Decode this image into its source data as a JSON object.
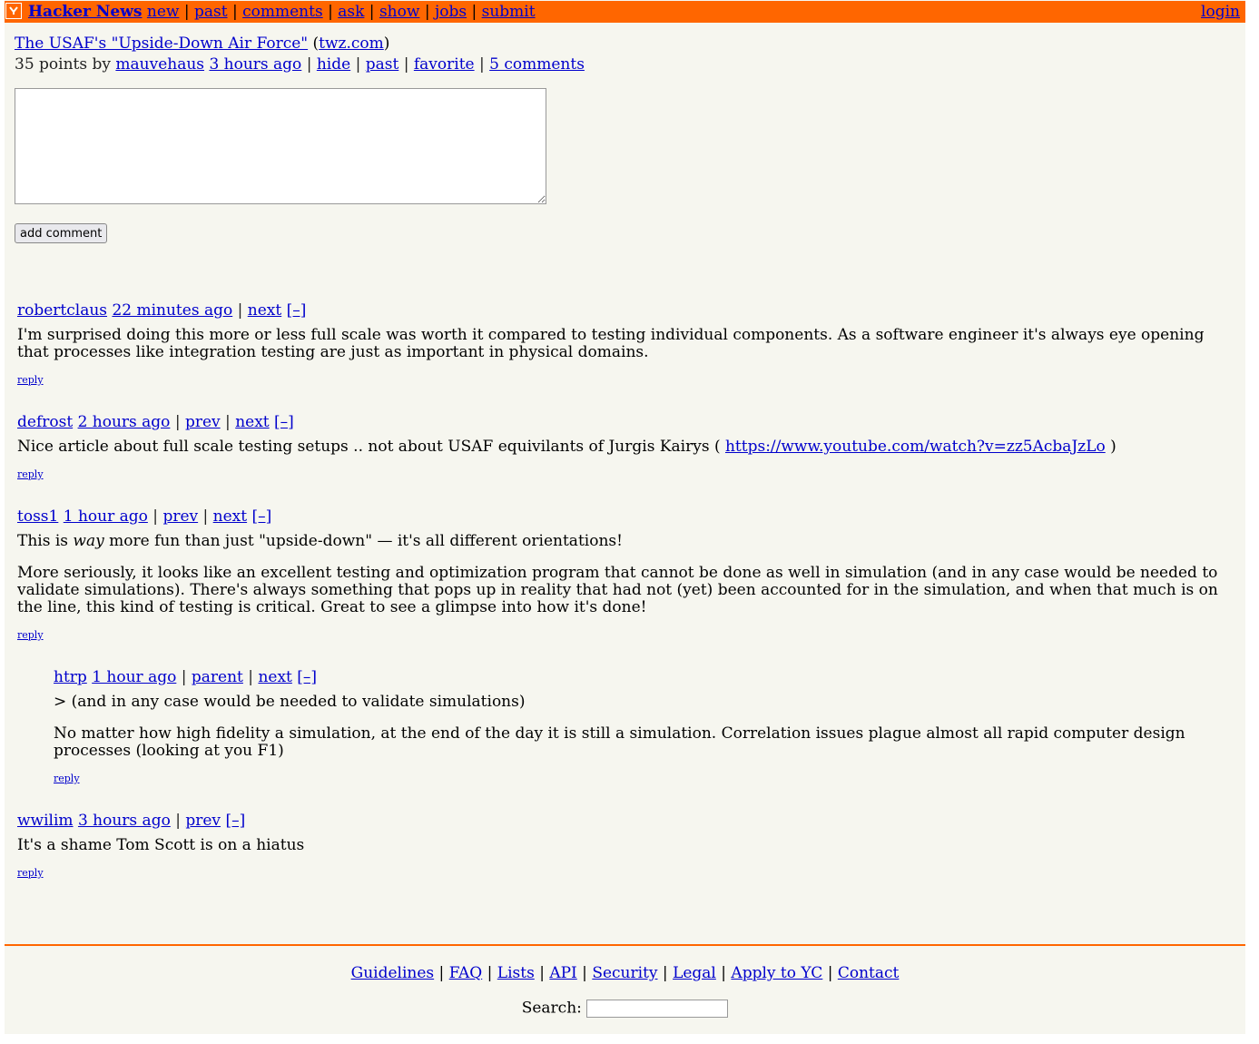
{
  "header": {
    "brand": "Hacker News",
    "nav": [
      "new",
      "past",
      "comments",
      "ask",
      "show",
      "jobs",
      "submit"
    ],
    "login": "login"
  },
  "story": {
    "title": "The USAF's \"Upside-Down Air Force\"",
    "site": "twz.com",
    "points": "35 points by",
    "author": "mauvehaus",
    "age": "3 hours ago",
    "links": [
      "hide",
      "past",
      "favorite",
      "5 comments"
    ]
  },
  "form": {
    "button_label": "add comment"
  },
  "comments": [
    {
      "user": "robertclaus",
      "age": "22 minutes ago",
      "nav": [
        "next",
        "[–]"
      ],
      "text": [
        "I'm surprised doing this more or less full scale was worth it compared to testing individual components. As a software engineer it's always eye opening that processes like integration testing are just as important in physical domains."
      ],
      "reply": "reply"
    },
    {
      "user": "defrost",
      "age": "2 hours ago",
      "nav": [
        "prev",
        "next",
        "[–]"
      ],
      "text_before": "Nice article about full scale testing setups .. not about USAF equivilants of Jurgis Kairys ( ",
      "link": "https://www.youtube.com/watch?v=zz5AcbaJzLo",
      "text_after": " )",
      "reply": "reply"
    },
    {
      "user": "toss1",
      "age": "1 hour ago",
      "nav": [
        "prev",
        "next",
        "[–]"
      ],
      "p1_before": "This is ",
      "p1_em": "way",
      "p1_after": " more fun than just \"upside-down\" — it's all different orientations!",
      "p2": "More seriously, it looks like an excellent testing and optimization program that cannot be done as well in simulation (and in any case would be needed to validate simulations). There's always something that pops up in reality that had not (yet) been accounted for in the simulation, and when that much is on the line, this kind of testing is critical. Great to see a glimpse into how it's done!",
      "reply": "reply"
    },
    {
      "user": "htrp",
      "age": "1 hour ago",
      "nav": [
        "parent",
        "next",
        "[–]"
      ],
      "p1": "> (and in any case would be needed to validate simulations)",
      "p2": "No matter how high fidelity a simulation, at the end of the day it is still a simulation. Correlation issues plague almost all rapid computer design processes (looking at you F1)",
      "reply": "reply"
    },
    {
      "user": "wwilim",
      "age": "3 hours ago",
      "nav": [
        "prev",
        "[–]"
      ],
      "text": [
        "It's a shame Tom Scott is on a hiatus"
      ],
      "reply": "reply"
    }
  ],
  "footer": {
    "links": [
      "Guidelines",
      "FAQ",
      "Lists",
      "API",
      "Security",
      "Legal",
      "Apply to YC",
      "Contact"
    ],
    "search_label": "Search:"
  },
  "colors": {
    "accent": "#ff6600",
    "background": "#f6f6ef",
    "link": "#0000cc"
  }
}
